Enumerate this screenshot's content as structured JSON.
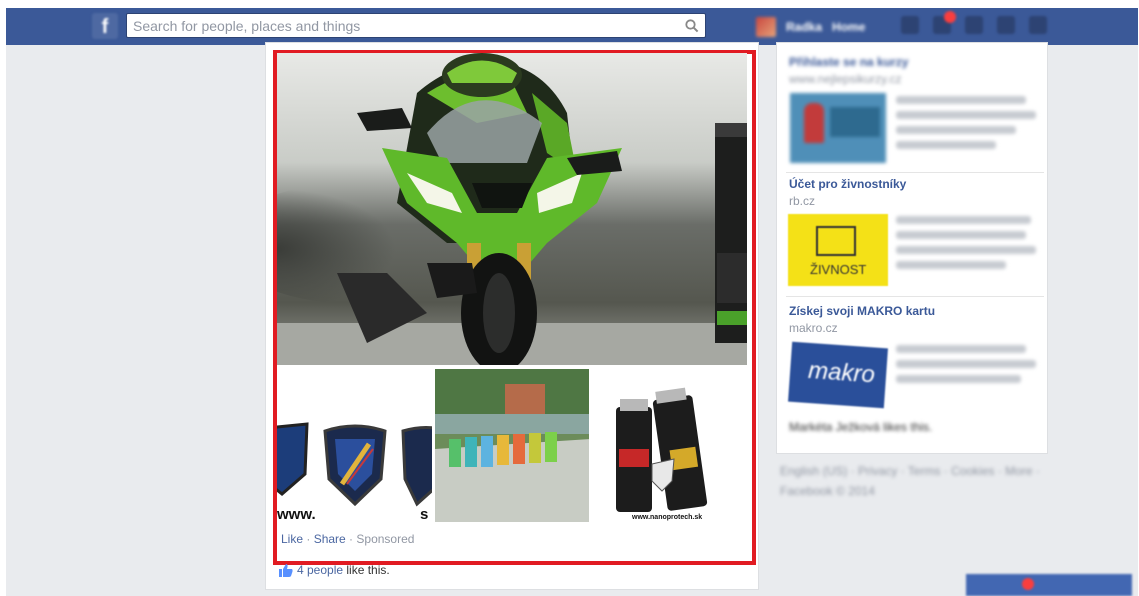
{
  "topbar": {
    "logo": "f",
    "search_placeholder": "Search for people, places and things",
    "user_name": "Radka",
    "home_label": "Home"
  },
  "post": {
    "actions": {
      "like": "Like",
      "separator": " · ",
      "share": "Share",
      "sponsored": "Sponsored"
    },
    "likes": {
      "count_text": "4 people",
      "suffix": " like this."
    },
    "thumb_texts": {
      "left_www": "www.",
      "left_s": "s",
      "right_site": "www.nanoprotech.sk"
    }
  },
  "sidebar": {
    "ads": [
      {
        "title": "Přihlaste se na kurzy",
        "domain": "www.nejlepsikurzy.cz",
        "blurred_title": true
      },
      {
        "title": "Účet pro živnostníky",
        "domain": "rb.cz",
        "img_text": "ŽIVNOST"
      },
      {
        "title": "Získej svoji MAKRO kartu",
        "domain": "makro.cz",
        "img_text": "makro",
        "caption": "Markéta Ježková likes this."
      }
    ],
    "footer": [
      "English (US) · Privacy · Terms · Cookies · More ·",
      "Facebook © 2014"
    ]
  },
  "colors": {
    "facebook_blue": "#3b5998",
    "ad_highlight": "#e11b22",
    "link": "#4b67a1"
  }
}
